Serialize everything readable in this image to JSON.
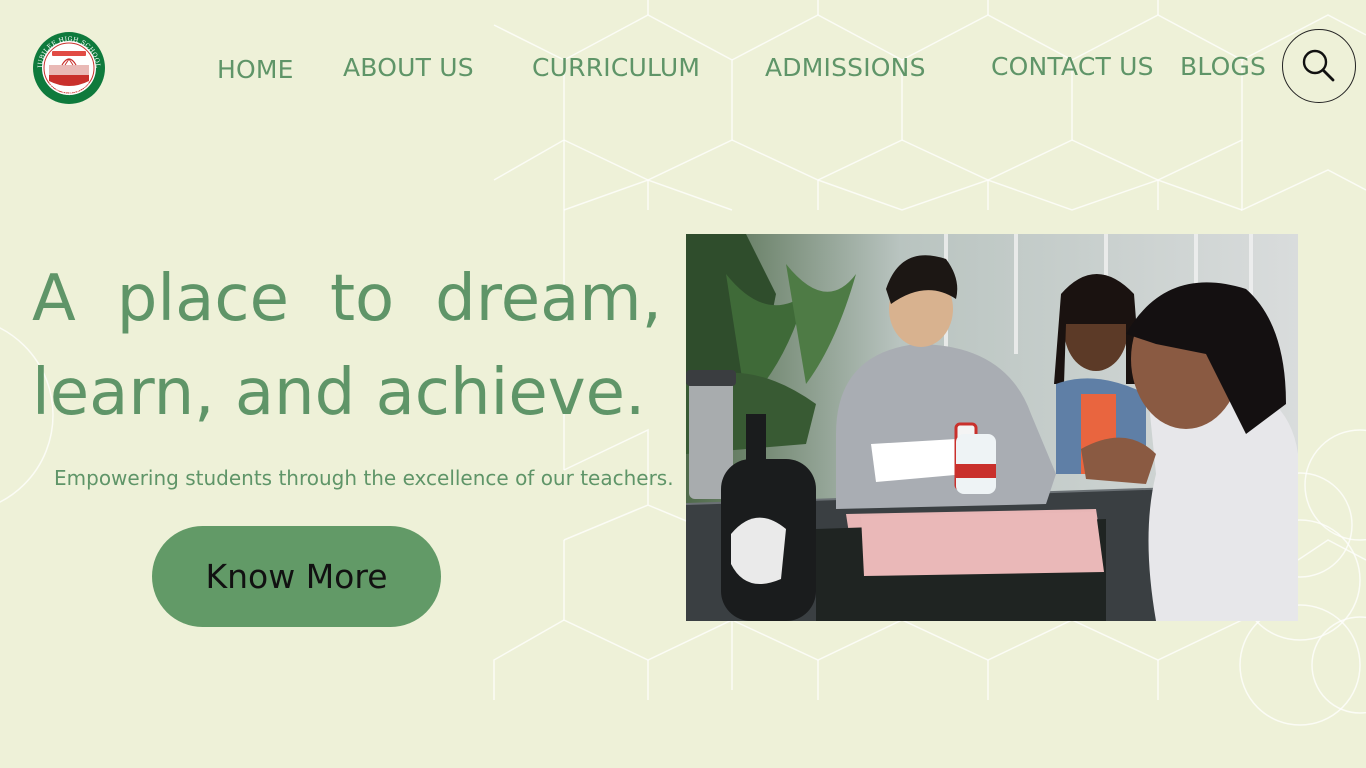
{
  "brand": {
    "logo_ring_text_top": "JUBILEE HIGH SCHOOL",
    "logo_ring_text_bottom": "NEW AGHAPURA",
    "logo_inner_text": "BY LOVE SERVE ONE ANOTHER",
    "colors": {
      "ring": "#0e7a3c",
      "accent": "#c9302c",
      "primary": "#5f9568",
      "background": "#eef1d8"
    }
  },
  "nav": {
    "items": [
      {
        "label": "HOME"
      },
      {
        "label": "ABOUT US"
      },
      {
        "label": "CURRICULUM"
      },
      {
        "label": "ADMISSIONS"
      },
      {
        "label": "CONTACT US"
      },
      {
        "label": "BLOGS"
      }
    ],
    "search_icon": "search-icon"
  },
  "hero": {
    "title_words_line1": [
      "A",
      "place",
      "to",
      "dream,"
    ],
    "title_line2": "learn, and achieve.",
    "subtitle": "Empowering students through the excellence of our teachers.",
    "cta_label": "Know More",
    "cta_color": "#629a67"
  },
  "photo": {
    "icon": "students-studying-photo"
  }
}
